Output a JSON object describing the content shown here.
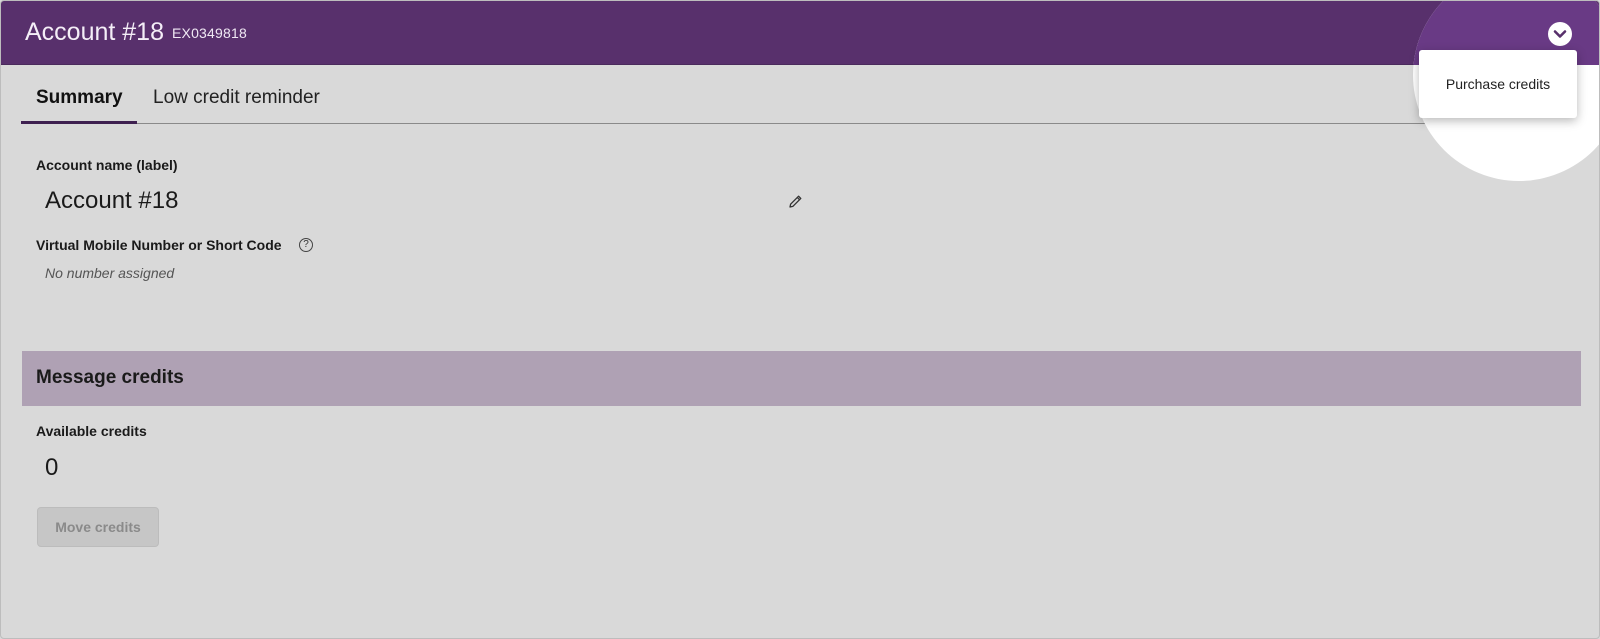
{
  "header": {
    "title": "Account #18",
    "account_code": "EX0349818",
    "menu_toggle_icon": "chevron-down-icon"
  },
  "dropdown": {
    "items": [
      {
        "label": "Purchase credits"
      }
    ]
  },
  "tabs": [
    {
      "label": "Summary",
      "active": true
    },
    {
      "label": "Low credit reminder",
      "active": false
    }
  ],
  "summary": {
    "account_name_label": "Account name (label)",
    "account_name_value": "Account #18",
    "edit_icon": "pencil-icon",
    "vmn_label": "Virtual Mobile Number or Short Code",
    "help_icon": "question-circle-icon",
    "help_icon_glyph": "?",
    "vmn_value": "No number assigned"
  },
  "message_credits": {
    "section_title": "Message credits",
    "available_label": "Available credits",
    "available_value": "0",
    "move_button_label": "Move credits",
    "move_button_disabled": true
  },
  "colors": {
    "header_bg": "#58306c",
    "section_bar_bg": "#afa1b4",
    "page_bg": "#d9d9d9"
  }
}
